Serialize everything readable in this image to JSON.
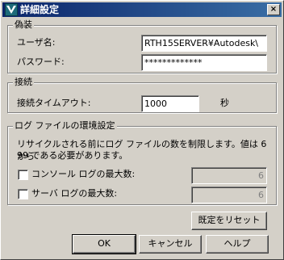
{
  "window": {
    "title": "詳細設定",
    "close_glyph": "×"
  },
  "impersonation": {
    "group_label": "偽装",
    "username_label": "ユーザ名:",
    "username_value": "RTH15SERVER¥Autodesk\\",
    "password_label": "パスワード:",
    "password_value": "*************"
  },
  "connection": {
    "group_label": "接続",
    "timeout_label": "接続タイムアウト:",
    "timeout_value": "1000",
    "timeout_unit": "秒"
  },
  "log_settings": {
    "group_label": "ログ ファイルの環境設定",
    "description_line1": "リサイクルされる前にログ ファイルの数を制限します。値は 6 から",
    "description_line2": "99 である必要があります。",
    "console_log_label": "コンソール ログの最大数:",
    "console_log_value": "6",
    "console_log_checked": false,
    "server_log_label": "サーバ ログの最大数:",
    "server_log_value": "6",
    "server_log_checked": false
  },
  "buttons": {
    "reset_defaults": "既定をリセット",
    "ok": "OK",
    "cancel": "キャンセル",
    "help": "ヘルプ"
  },
  "icons": {
    "window_icon": "app-logo-icon"
  }
}
